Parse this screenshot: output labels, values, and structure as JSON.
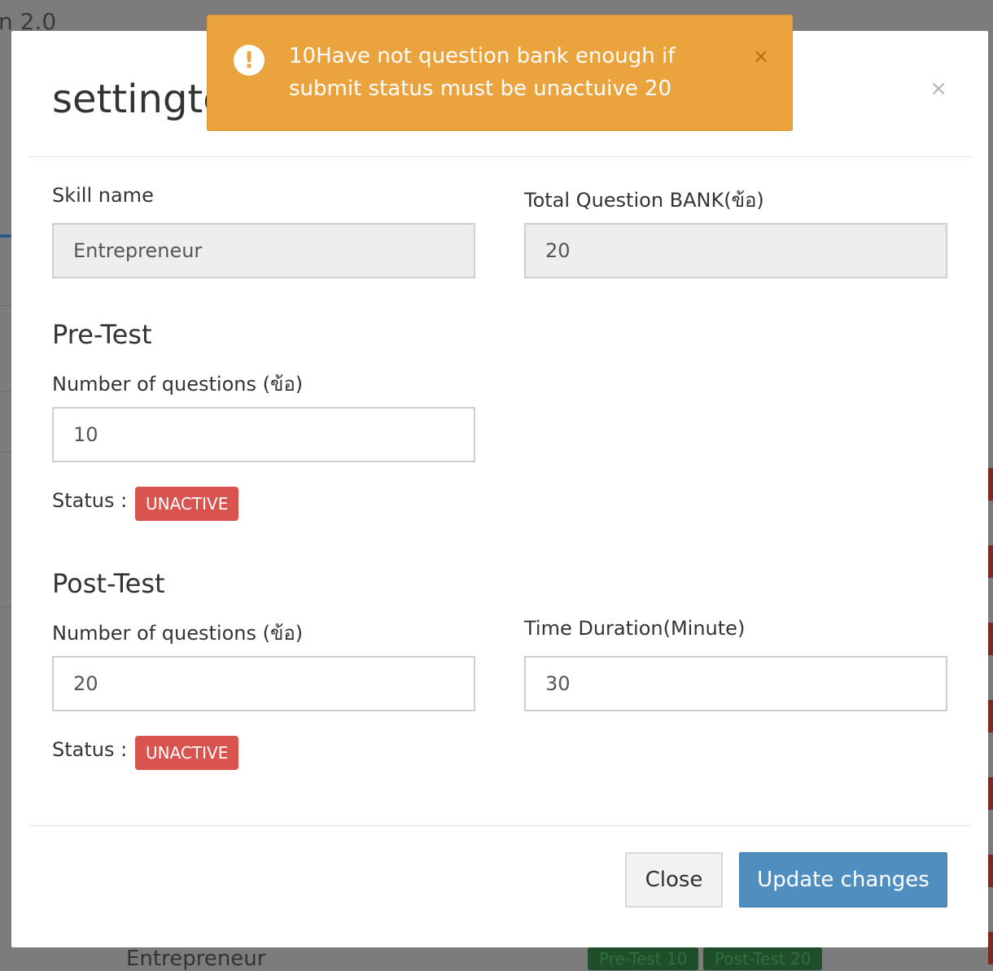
{
  "background": {
    "title_fragment": "n 2.0",
    "under_item": "Entrepreneur",
    "under_badges": [
      "Pre-Test 10",
      "Post-Test 20"
    ]
  },
  "toast": {
    "icon": "exclamation-icon",
    "message": "10Have not question bank enough if submit status must be unactuive 20",
    "close_symbol": "×",
    "color": "#eba33e"
  },
  "modal": {
    "title": "settingte",
    "close_symbol": "×",
    "skill_name": {
      "label": "Skill name",
      "value": "Entrepreneur"
    },
    "total_bank": {
      "label": "Total Question BANK(ข้อ)",
      "value": "20"
    },
    "pre_test": {
      "title": "Pre-Test",
      "questions_label": "Number of questions (ข้อ)",
      "questions_value": "10",
      "status_label": "Status :",
      "status": "UNACTIVE"
    },
    "post_test": {
      "title": "Post-Test",
      "questions_label": "Number of questions (ข้อ)",
      "questions_value": "20",
      "duration_label": "Time Duration(Minute)",
      "duration_value": "30",
      "status_label": "Status :",
      "status": "UNACTIVE"
    },
    "footer": {
      "close_label": "Close",
      "update_label": "Update changes"
    }
  },
  "colors": {
    "danger": "#d9534f",
    "primary": "#4f8ebf",
    "warning": "#eba33e"
  }
}
